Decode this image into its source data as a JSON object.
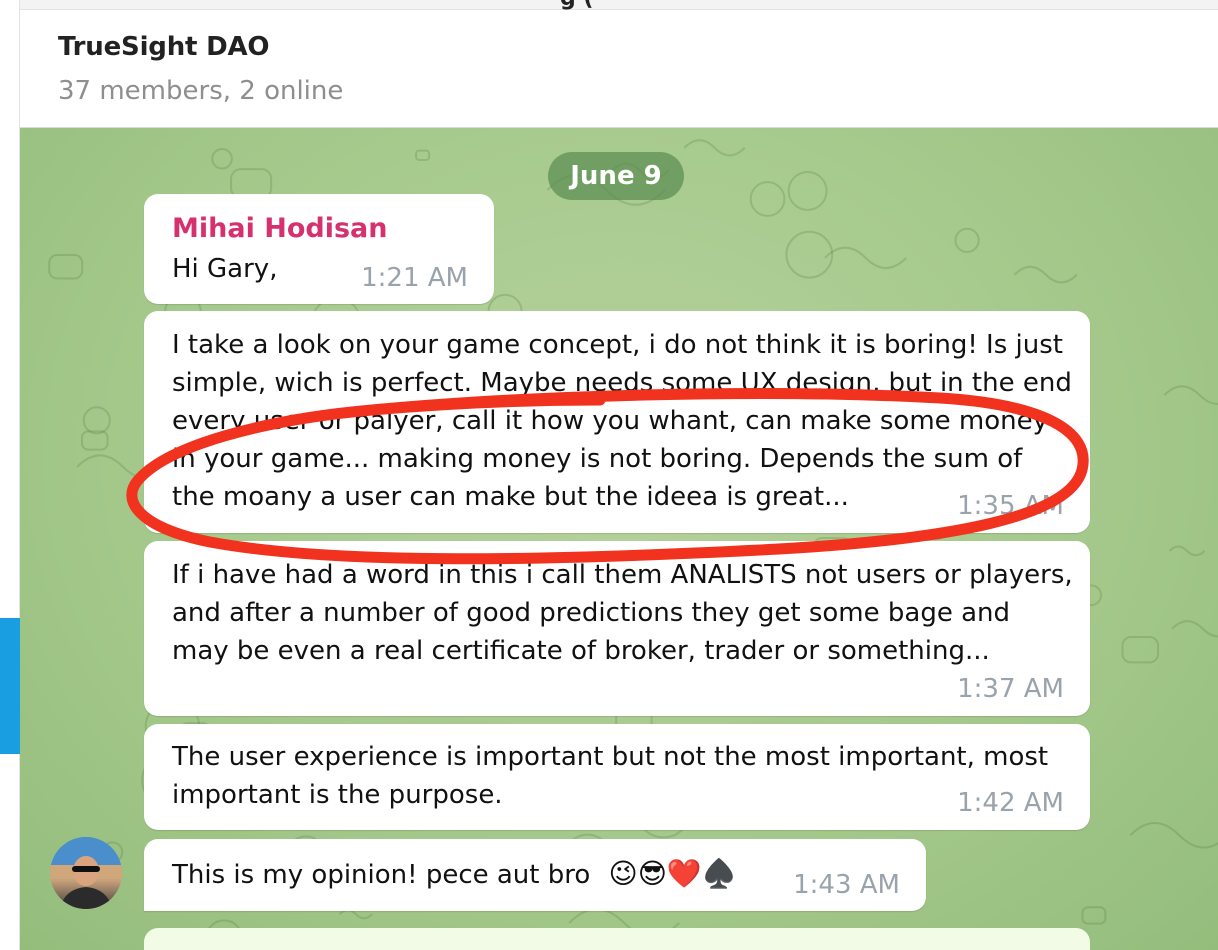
{
  "window": {
    "title_fragment": "g ("
  },
  "header": {
    "title": "TrueSight DAO",
    "status": "37 members, 2 online"
  },
  "chat": {
    "date_separator": "June 9",
    "messages": [
      {
        "sender": "Mihai Hodisan",
        "lines": [
          "Hi Gary,"
        ],
        "time": "1:21 AM"
      },
      {
        "lines": [
          "I take a look on your game concept, i do not think it is boring! Is just",
          "simple, wich is perfect. Maybe needs some UX design, but in the end",
          "every user or palyer, call it how you whant, can make some money",
          "in your game... making money is not boring. Depends the sum of",
          "the moany a user can make but the ideea is great..."
        ],
        "time": "1:35 AM"
      },
      {
        "lines": [
          "If i have had a word in this i call them ANALISTS not users or players,",
          "and after a number of good predictions they get some bage and",
          "may be even a real certificate of broker, trader or something..."
        ],
        "time": "1:37 AM"
      },
      {
        "lines": [
          "The user experience is important but not the most important, most",
          "important is the purpose."
        ],
        "time": "1:42 AM"
      },
      {
        "lines": [
          "This is my opinion! pece aut bro"
        ],
        "emoji": "😉😎❤️♠️",
        "time": "1:43 AM"
      }
    ]
  },
  "colors": {
    "accent": "#1a9ee2",
    "sender_name": "#d6306f",
    "annotation": "#f0321e",
    "date_pill": "#5c8c52"
  },
  "icons": [
    "avatar"
  ]
}
